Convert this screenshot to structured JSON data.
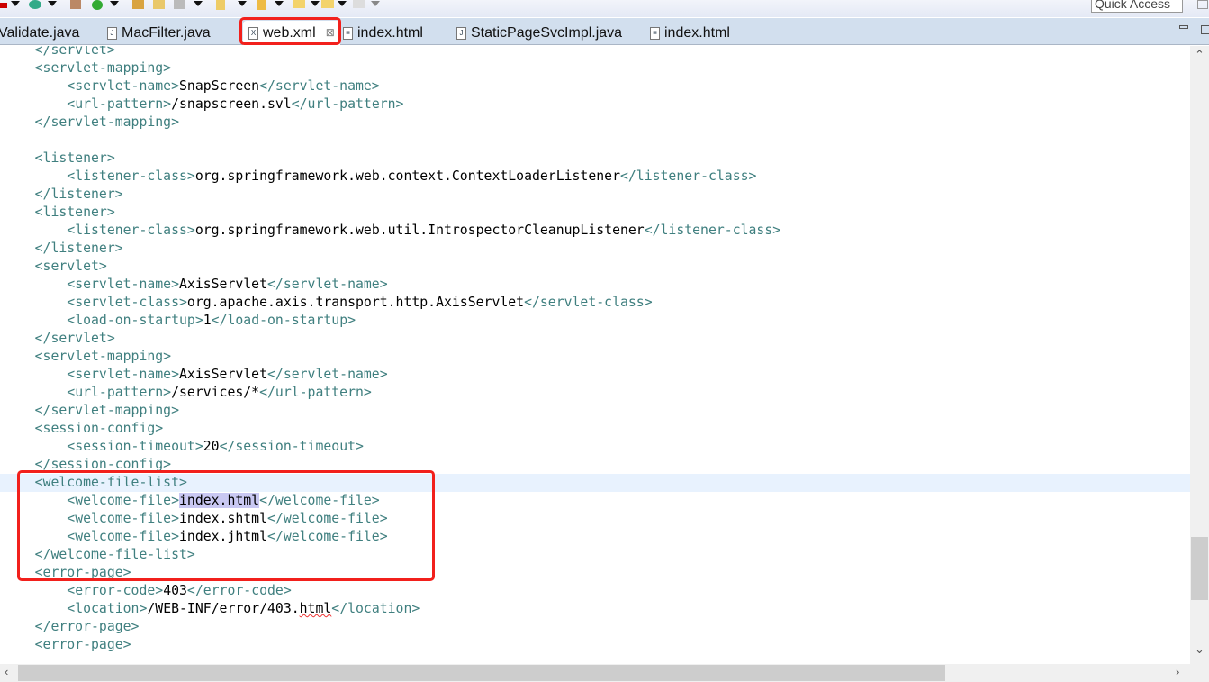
{
  "toolbar": {
    "quick_access": "Quick Access"
  },
  "tabs": [
    {
      "label": "Validate.java",
      "icon": "java-file-icon"
    },
    {
      "label": "MacFilter.java",
      "icon": "java-file-icon"
    },
    {
      "label": "web.xml",
      "icon": "xml-file-icon",
      "active": true
    },
    {
      "label": "index.html",
      "icon": "html-file-icon"
    },
    {
      "label": "StaticPageSvcImpl.java",
      "icon": "java-file-icon"
    },
    {
      "label": "index.html",
      "icon": "html-file-icon"
    }
  ],
  "editor": {
    "current_line": 24,
    "selection": {
      "line": 25,
      "text": "index.html"
    },
    "warning": {
      "line": 31,
      "text": "html"
    },
    "lines": [
      "    </servlet>",
      "    <servlet-mapping>",
      "        <servlet-name>SnapScreen</servlet-name>",
      "        <url-pattern>/snapscreen.svl</url-pattern>",
      "    </servlet-mapping>",
      "",
      "    <listener>",
      "        <listener-class>org.springframework.web.context.ContextLoaderListener</listener-class>",
      "    </listener>",
      "    <listener>",
      "        <listener-class>org.springframework.web.util.IntrospectorCleanupListener</listener-class>",
      "    </listener>",
      "    <servlet>",
      "        <servlet-name>AxisServlet</servlet-name>",
      "        <servlet-class>org.apache.axis.transport.http.AxisServlet</servlet-class>",
      "        <load-on-startup>1</load-on-startup>",
      "    </servlet>",
      "    <servlet-mapping>",
      "        <servlet-name>AxisServlet</servlet-name>",
      "        <url-pattern>/services/*</url-pattern>",
      "    </servlet-mapping>",
      "    <session-config>",
      "        <session-timeout>20</session-timeout>",
      "    </session-config>",
      "    <welcome-file-list>",
      "        <welcome-file>index.html</welcome-file>",
      "        <welcome-file>index.shtml</welcome-file>",
      "        <welcome-file>index.jhtml</welcome-file>",
      "    </welcome-file-list>",
      "    <error-page>",
      "        <error-code>403</error-code>",
      "        <location>/WEB-INF/error/403.html</location>",
      "    </error-page>",
      "    <error-page>"
    ]
  }
}
